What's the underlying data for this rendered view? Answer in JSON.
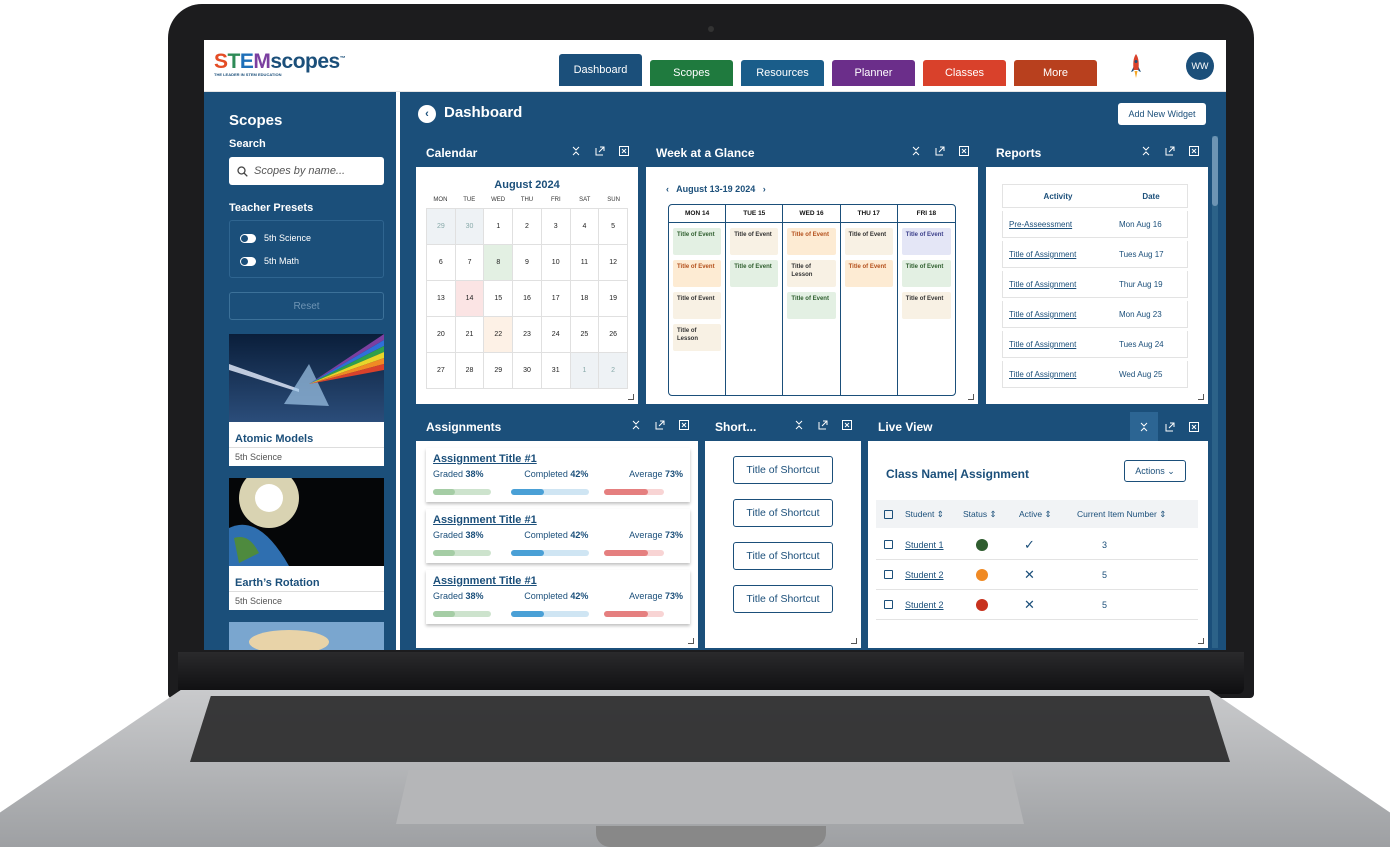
{
  "header": {
    "logo": {
      "s": "S",
      "t": "T",
      "e": "E",
      "m": "M",
      "rest": "scopes",
      "tm": "™",
      "tagline": "THE LEADER IN STEM EDUCATION"
    },
    "tabs": [
      {
        "label": "Dashboard",
        "color": "#1b4f7a"
      },
      {
        "label": "Scopes",
        "color": "#1f7a3e"
      },
      {
        "label": "Resources",
        "color": "#1a5d8a"
      },
      {
        "label": "Planner",
        "color": "#6b2e8a"
      },
      {
        "label": "Classes",
        "color": "#d9412b"
      },
      {
        "label": "More",
        "color": "#b8401e"
      }
    ],
    "avatar": "WW"
  },
  "sidebar": {
    "title": "Scopes",
    "search_label": "Search",
    "search_placeholder": "Scopes by name...",
    "presets_label": "Teacher Presets",
    "presets": [
      "5th Science",
      "5th Math"
    ],
    "reset_label": "Reset",
    "scopes": [
      {
        "name": "Atomic Models",
        "grade": "5th Science"
      },
      {
        "name": "Earth’s Rotation",
        "grade": "5th Science"
      }
    ]
  },
  "dashboard": {
    "title": "Dashboard",
    "add_widget_label": "Add New Widget"
  },
  "calendar": {
    "title": "Calendar",
    "month": "August 2024",
    "dow": [
      "MON",
      "TUE",
      "WED",
      "THU",
      "FRI",
      "SAT",
      "SUN"
    ],
    "days": [
      "29",
      "30",
      "1",
      "2",
      "3",
      "4",
      "5",
      "6",
      "7",
      "8",
      "9",
      "10",
      "11",
      "12",
      "13",
      "14",
      "15",
      "16",
      "17",
      "18",
      "19",
      "20",
      "21",
      "22",
      "23",
      "24",
      "25",
      "26",
      "27",
      "28",
      "29",
      "30",
      "31",
      "1",
      "2"
    ]
  },
  "week": {
    "title": "Week at a Glance",
    "range": "August 13-19 2024",
    "days": [
      {
        "label": "MON 14",
        "events": [
          {
            "text": "Title of Event",
            "tone": "g"
          },
          {
            "text": "Title of Event",
            "tone": "o"
          },
          {
            "text": "Title of Event",
            "tone": "y"
          },
          {
            "text": "Title of Lesson",
            "tone": "y"
          }
        ]
      },
      {
        "label": "TUE 15",
        "events": [
          {
            "text": "Title of Event",
            "tone": "y"
          },
          {
            "text": "Title of Event",
            "tone": "g"
          }
        ]
      },
      {
        "label": "WED 16",
        "events": [
          {
            "text": "Title of Event",
            "tone": "o"
          },
          {
            "text": "Title of Lesson",
            "tone": "y"
          },
          {
            "text": "Title of Event",
            "tone": "g"
          }
        ]
      },
      {
        "label": "THU 17",
        "events": [
          {
            "text": "Title of Event",
            "tone": "y"
          },
          {
            "text": "Title of Event",
            "tone": "o"
          }
        ]
      },
      {
        "label": "FRI 18",
        "events": [
          {
            "text": "Title of Event",
            "tone": "p"
          },
          {
            "text": "Title of Event",
            "tone": "g"
          },
          {
            "text": "Title of Event",
            "tone": "y"
          }
        ]
      }
    ]
  },
  "reports": {
    "title": "Reports",
    "headers": [
      "Activity",
      "Date"
    ],
    "rows": [
      {
        "activity": "Pre-Asseessment",
        "date": "Mon Aug 16"
      },
      {
        "activity": "Title of Assignment",
        "date": "Tues Aug 17"
      },
      {
        "activity": "Title of Assignment",
        "date": "Thur Aug 19"
      },
      {
        "activity": "Title of Assignment",
        "date": "Mon Aug 23"
      },
      {
        "activity": "Title of Assignment",
        "date": "Tues Aug 24"
      },
      {
        "activity": "Title of Assignment",
        "date": "Wed Aug 25"
      }
    ]
  },
  "assignments": {
    "title": "Assignments",
    "items": [
      {
        "title": "Assignment Title #1",
        "graded_label": "Graded",
        "graded": "38%",
        "completed_label": "Completed",
        "completed": "42%",
        "average_label": "Average",
        "average": "73%"
      },
      {
        "title": "Assignment Title #1",
        "graded_label": "Graded",
        "graded": "38%",
        "completed_label": "Completed",
        "completed": "42%",
        "average_label": "Average",
        "average": "73%"
      },
      {
        "title": "Assignment Title #1",
        "graded_label": "Graded",
        "graded": "38%",
        "completed_label": "Completed",
        "completed": "42%",
        "average_label": "Average",
        "average": "73%"
      }
    ]
  },
  "shortcuts": {
    "title": "Short...",
    "items": [
      "Title of Shortcut",
      "Title of Shortcut",
      "Title of Shortcut",
      "Title of Shortcut"
    ]
  },
  "liveview": {
    "title": "Live View",
    "class_title": "Class Name| Assignment",
    "actions_label": "Actions",
    "headers": [
      "Student",
      "Status",
      "Active",
      "Current Item Number"
    ],
    "rows": [
      {
        "student": "Student 1",
        "status_color": "#2f5d2f",
        "active": "✓",
        "item": "3"
      },
      {
        "student": "Student 2",
        "status_color": "#f08a24",
        "active": "✕",
        "item": "5"
      },
      {
        "student": "Student 2",
        "status_color": "#c8321e",
        "active": "✕",
        "item": "5"
      }
    ]
  }
}
